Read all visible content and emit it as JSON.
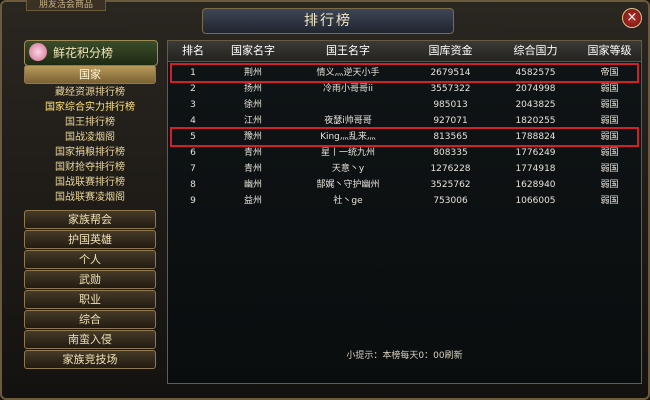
{
  "window": {
    "corner_tab_text": "朋友活会商品",
    "title": "排行榜",
    "close_label": "×"
  },
  "sidebar": {
    "header": "鲜花积分榜",
    "categories_top": [
      {
        "label": "国家",
        "active": true
      }
    ],
    "subitems": [
      {
        "label": "藏经资源排行榜"
      },
      {
        "label": "国家综合实力排行榜",
        "highlight": true
      },
      {
        "label": "国王排行榜"
      },
      {
        "label": "国战凌烟阁"
      },
      {
        "label": "国家捐粮排行榜"
      },
      {
        "label": "国财抢夺排行榜"
      },
      {
        "label": "国战联赛排行榜"
      },
      {
        "label": "国战联赛凌烟阁"
      }
    ],
    "categories_bottom": [
      {
        "label": "家族帮会"
      },
      {
        "label": "护国英雄"
      },
      {
        "label": "个人"
      },
      {
        "label": "武勋"
      },
      {
        "label": "职业"
      },
      {
        "label": "综合"
      },
      {
        "label": "南蛮入侵"
      },
      {
        "label": "家族竞技场"
      }
    ]
  },
  "table": {
    "headers": [
      "排名",
      "国家名字",
      "国王名字",
      "国库资金",
      "综合国力",
      "国家等级"
    ],
    "rows": [
      [
        "1",
        "荆州",
        "情义灬逆天小手",
        "2679514",
        "4582575",
        "帝国"
      ],
      [
        "2",
        "扬州",
        "冷雨小哥哥ii",
        "3557322",
        "2074998",
        "弱国"
      ],
      [
        "3",
        "徐州",
        "",
        "985013",
        "2043825",
        "弱国"
      ],
      [
        "4",
        "江州",
        "夜瑟i帅哥哥",
        "927071",
        "1820255",
        "弱国"
      ],
      [
        "5",
        "豫州",
        "King灬乱来灬",
        "813565",
        "1788824",
        "弱国"
      ],
      [
        "6",
        "青州",
        "星丨一统九州",
        "808335",
        "1776249",
        "弱国"
      ],
      [
        "7",
        "青州",
        "天意丶y",
        "1276228",
        "1774918",
        "弱国"
      ],
      [
        "8",
        "幽州",
        "郜娓丶守护幽州",
        "3525762",
        "1628940",
        "弱国"
      ],
      [
        "9",
        "益州",
        "社丶ge",
        "753006",
        "1066005",
        "弱国"
      ]
    ],
    "highlighted_ranks": [
      "1",
      "5"
    ]
  },
  "tip": "小提示：本榜每天0：00刷新",
  "colors": {
    "highlight_box": "#d21f2a",
    "accent_gold": "#b89a5a"
  }
}
